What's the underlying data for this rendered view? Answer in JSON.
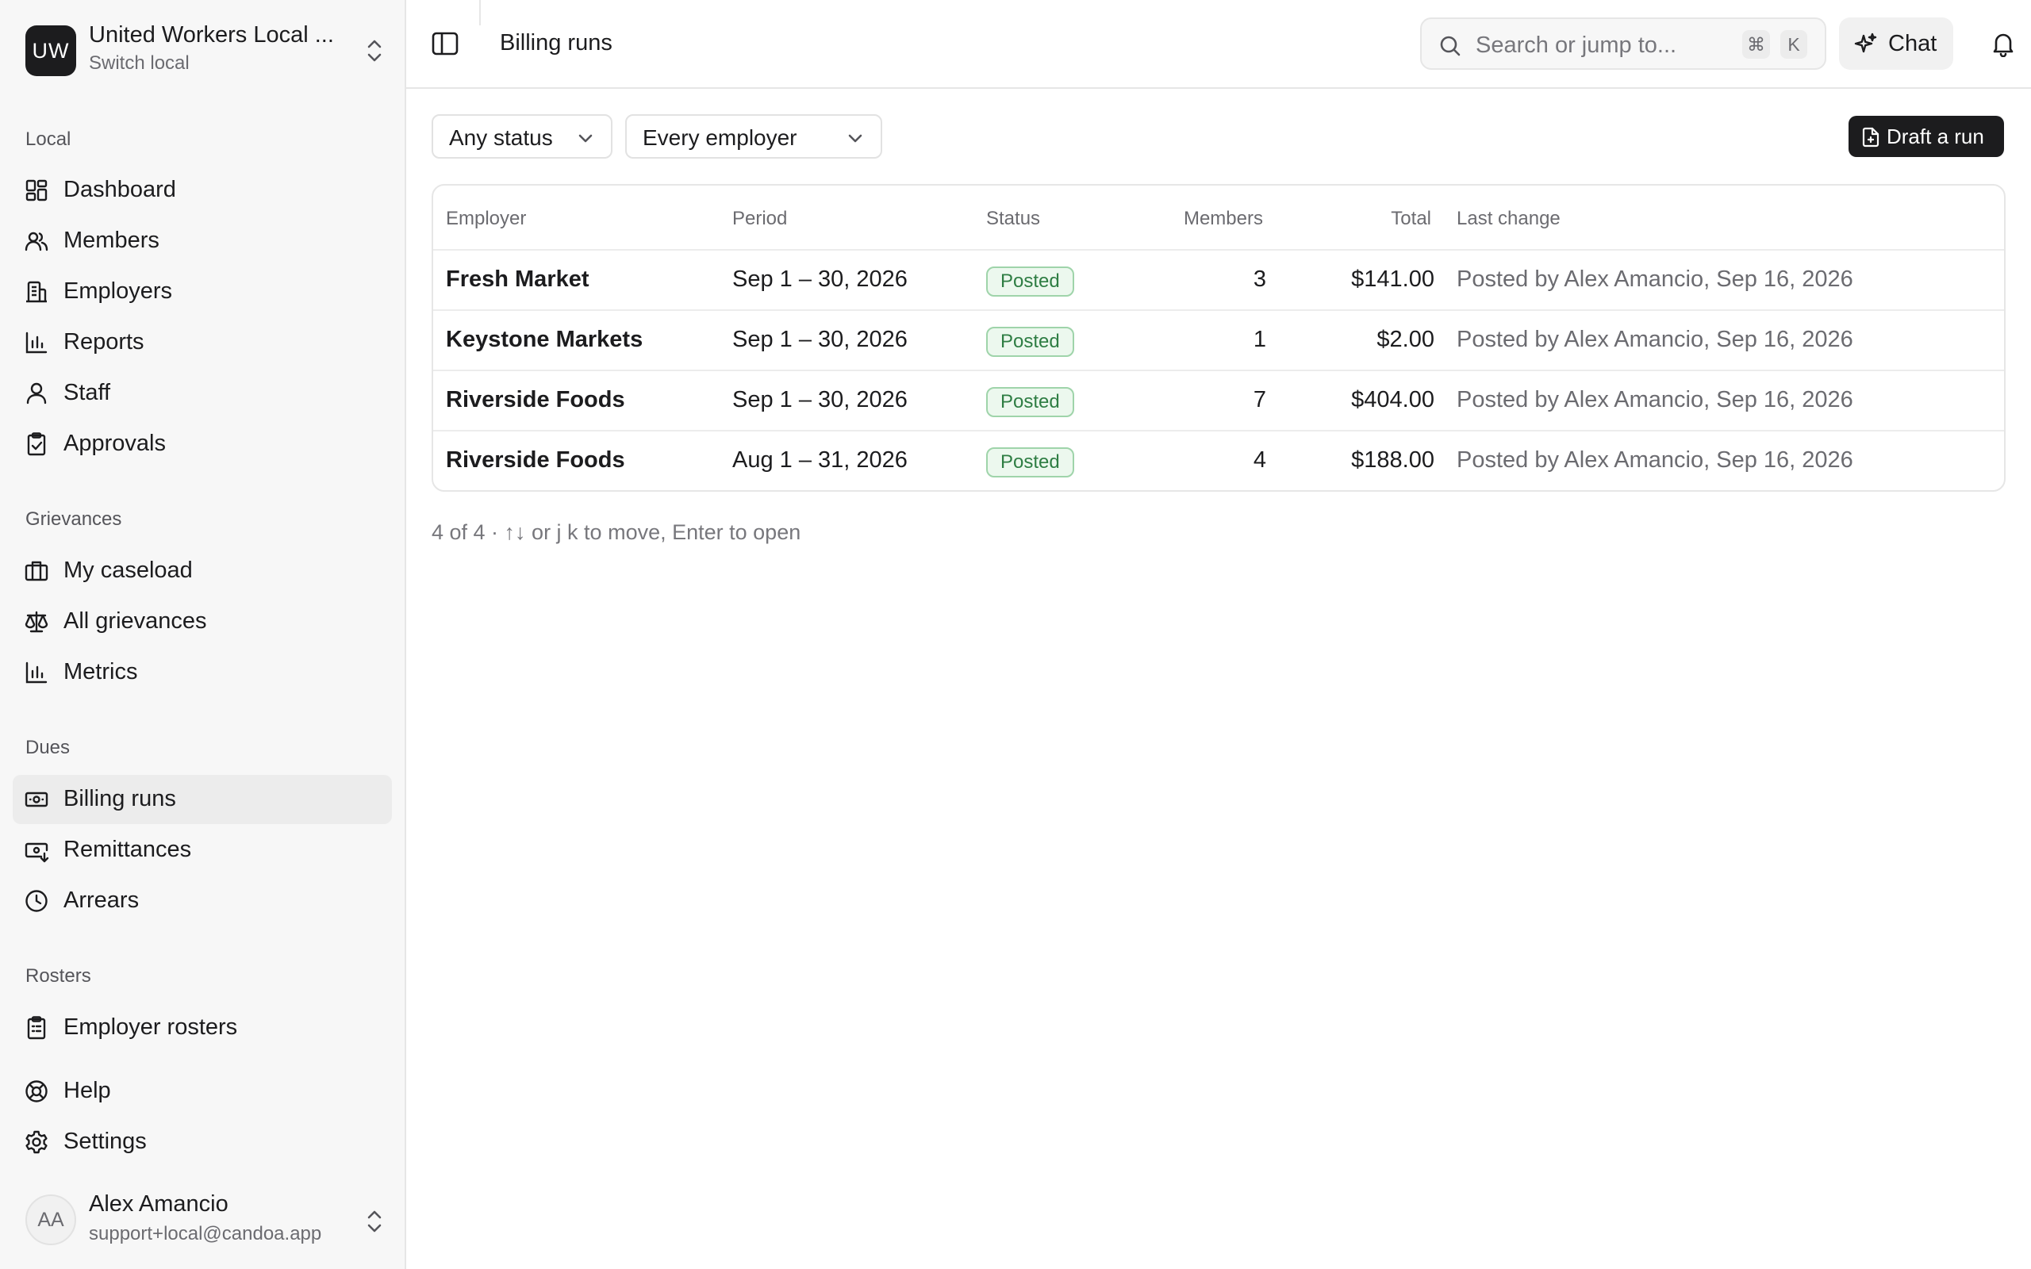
{
  "local": {
    "avatar_initials": "UW",
    "name": "United Workers Local ...",
    "subtitle": "Switch local"
  },
  "sidebar": {
    "sections": [
      {
        "label": "Local",
        "items": [
          {
            "label": "Dashboard",
            "icon": "dashboard-icon"
          },
          {
            "label": "Members",
            "icon": "members-icon"
          },
          {
            "label": "Employers",
            "icon": "employers-icon"
          },
          {
            "label": "Reports",
            "icon": "reports-icon"
          },
          {
            "label": "Staff",
            "icon": "staff-icon"
          },
          {
            "label": "Approvals",
            "icon": "approvals-icon"
          }
        ]
      },
      {
        "label": "Grievances",
        "items": [
          {
            "label": "My caseload",
            "icon": "briefcase-icon"
          },
          {
            "label": "All grievances",
            "icon": "scales-icon"
          },
          {
            "label": "Metrics",
            "icon": "metrics-icon"
          }
        ]
      },
      {
        "label": "Dues",
        "items": [
          {
            "label": "Billing runs",
            "icon": "billing-icon",
            "active": true
          },
          {
            "label": "Remittances",
            "icon": "remittances-icon"
          },
          {
            "label": "Arrears",
            "icon": "clock-icon"
          }
        ]
      },
      {
        "label": "Rosters",
        "items": [
          {
            "label": "Employer rosters",
            "icon": "clipboard-icon"
          }
        ]
      }
    ],
    "bottom_items": [
      {
        "label": "Help",
        "icon": "help-icon"
      },
      {
        "label": "Settings",
        "icon": "gear-icon"
      }
    ]
  },
  "user": {
    "initials": "AA",
    "name": "Alex Amancio",
    "email": "support+local@candoa.app"
  },
  "topbar": {
    "title": "Billing runs",
    "search_placeholder": "Search or jump to...",
    "shortcut_keys": [
      "⌘",
      "K"
    ],
    "chat_label": "Chat"
  },
  "filters": {
    "status": "Any status",
    "employer": "Every employer"
  },
  "actions": {
    "draft_label": "Draft a run"
  },
  "table": {
    "columns": [
      "Employer",
      "Period",
      "Status",
      "Members",
      "Total",
      "Last change"
    ],
    "rows": [
      {
        "employer": "Fresh Market",
        "period": "Sep 1 – 30, 2026",
        "status": "Posted",
        "members": "3",
        "total": "$141.00",
        "last_change": "Posted by Alex Amancio, Sep 16, 2026"
      },
      {
        "employer": "Keystone Markets",
        "period": "Sep 1 – 30, 2026",
        "status": "Posted",
        "members": "1",
        "total": "$2.00",
        "last_change": "Posted by Alex Amancio, Sep 16, 2026"
      },
      {
        "employer": "Riverside Foods",
        "period": "Sep 1 – 30, 2026",
        "status": "Posted",
        "members": "7",
        "total": "$404.00",
        "last_change": "Posted by Alex Amancio, Sep 16, 2026"
      },
      {
        "employer": "Riverside Foods",
        "period": "Aug 1 – 31, 2026",
        "status": "Posted",
        "members": "4",
        "total": "$188.00",
        "last_change": "Posted by Alex Amancio, Sep 16, 2026"
      }
    ]
  },
  "footer": {
    "hint": "4 of 4 · ↑↓ or j k to move, Enter to open"
  },
  "colors": {
    "accent": "#1c1c1e",
    "status_posted_text": "#2e7d43",
    "status_posted_bg": "#ecf8ee",
    "status_posted_border": "#9fd4aa"
  }
}
